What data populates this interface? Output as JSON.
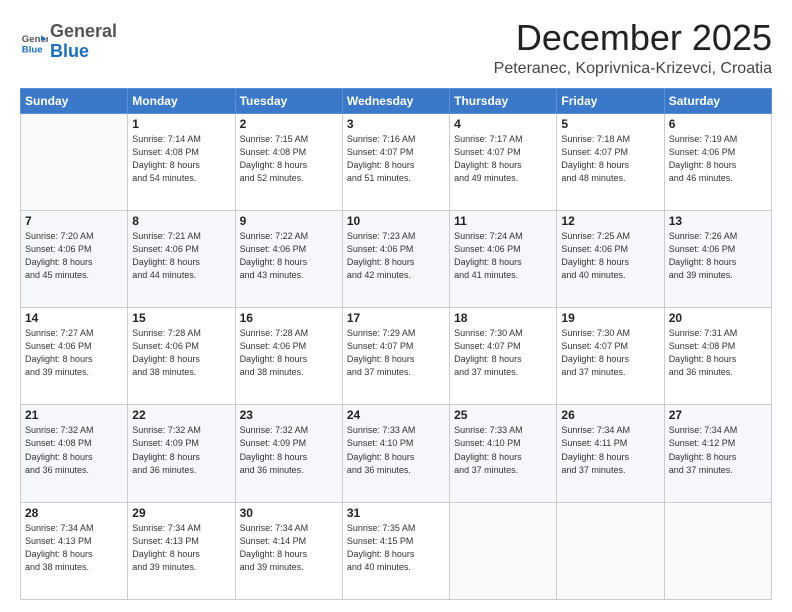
{
  "logo": {
    "general": "General",
    "blue": "Blue"
  },
  "header": {
    "month_year": "December 2025",
    "location": "Peteranec, Koprivnica-Krizevci, Croatia"
  },
  "days_of_week": [
    "Sunday",
    "Monday",
    "Tuesday",
    "Wednesday",
    "Thursday",
    "Friday",
    "Saturday"
  ],
  "weeks": [
    [
      {
        "day": "",
        "info": ""
      },
      {
        "day": "1",
        "info": "Sunrise: 7:14 AM\nSunset: 4:08 PM\nDaylight: 8 hours\nand 54 minutes."
      },
      {
        "day": "2",
        "info": "Sunrise: 7:15 AM\nSunset: 4:08 PM\nDaylight: 8 hours\nand 52 minutes."
      },
      {
        "day": "3",
        "info": "Sunrise: 7:16 AM\nSunset: 4:07 PM\nDaylight: 8 hours\nand 51 minutes."
      },
      {
        "day": "4",
        "info": "Sunrise: 7:17 AM\nSunset: 4:07 PM\nDaylight: 8 hours\nand 49 minutes."
      },
      {
        "day": "5",
        "info": "Sunrise: 7:18 AM\nSunset: 4:07 PM\nDaylight: 8 hours\nand 48 minutes."
      },
      {
        "day": "6",
        "info": "Sunrise: 7:19 AM\nSunset: 4:06 PM\nDaylight: 8 hours\nand 46 minutes."
      }
    ],
    [
      {
        "day": "7",
        "info": "Sunrise: 7:20 AM\nSunset: 4:06 PM\nDaylight: 8 hours\nand 45 minutes."
      },
      {
        "day": "8",
        "info": "Sunrise: 7:21 AM\nSunset: 4:06 PM\nDaylight: 8 hours\nand 44 minutes."
      },
      {
        "day": "9",
        "info": "Sunrise: 7:22 AM\nSunset: 4:06 PM\nDaylight: 8 hours\nand 43 minutes."
      },
      {
        "day": "10",
        "info": "Sunrise: 7:23 AM\nSunset: 4:06 PM\nDaylight: 8 hours\nand 42 minutes."
      },
      {
        "day": "11",
        "info": "Sunrise: 7:24 AM\nSunset: 4:06 PM\nDaylight: 8 hours\nand 41 minutes."
      },
      {
        "day": "12",
        "info": "Sunrise: 7:25 AM\nSunset: 4:06 PM\nDaylight: 8 hours\nand 40 minutes."
      },
      {
        "day": "13",
        "info": "Sunrise: 7:26 AM\nSunset: 4:06 PM\nDaylight: 8 hours\nand 39 minutes."
      }
    ],
    [
      {
        "day": "14",
        "info": "Sunrise: 7:27 AM\nSunset: 4:06 PM\nDaylight: 8 hours\nand 39 minutes."
      },
      {
        "day": "15",
        "info": "Sunrise: 7:28 AM\nSunset: 4:06 PM\nDaylight: 8 hours\nand 38 minutes."
      },
      {
        "day": "16",
        "info": "Sunrise: 7:28 AM\nSunset: 4:06 PM\nDaylight: 8 hours\nand 38 minutes."
      },
      {
        "day": "17",
        "info": "Sunrise: 7:29 AM\nSunset: 4:07 PM\nDaylight: 8 hours\nand 37 minutes."
      },
      {
        "day": "18",
        "info": "Sunrise: 7:30 AM\nSunset: 4:07 PM\nDaylight: 8 hours\nand 37 minutes."
      },
      {
        "day": "19",
        "info": "Sunrise: 7:30 AM\nSunset: 4:07 PM\nDaylight: 8 hours\nand 37 minutes."
      },
      {
        "day": "20",
        "info": "Sunrise: 7:31 AM\nSunset: 4:08 PM\nDaylight: 8 hours\nand 36 minutes."
      }
    ],
    [
      {
        "day": "21",
        "info": "Sunrise: 7:32 AM\nSunset: 4:08 PM\nDaylight: 8 hours\nand 36 minutes."
      },
      {
        "day": "22",
        "info": "Sunrise: 7:32 AM\nSunset: 4:09 PM\nDaylight: 8 hours\nand 36 minutes."
      },
      {
        "day": "23",
        "info": "Sunrise: 7:32 AM\nSunset: 4:09 PM\nDaylight: 8 hours\nand 36 minutes."
      },
      {
        "day": "24",
        "info": "Sunrise: 7:33 AM\nSunset: 4:10 PM\nDaylight: 8 hours\nand 36 minutes."
      },
      {
        "day": "25",
        "info": "Sunrise: 7:33 AM\nSunset: 4:10 PM\nDaylight: 8 hours\nand 37 minutes."
      },
      {
        "day": "26",
        "info": "Sunrise: 7:34 AM\nSunset: 4:11 PM\nDaylight: 8 hours\nand 37 minutes."
      },
      {
        "day": "27",
        "info": "Sunrise: 7:34 AM\nSunset: 4:12 PM\nDaylight: 8 hours\nand 37 minutes."
      }
    ],
    [
      {
        "day": "28",
        "info": "Sunrise: 7:34 AM\nSunset: 4:13 PM\nDaylight: 8 hours\nand 38 minutes."
      },
      {
        "day": "29",
        "info": "Sunrise: 7:34 AM\nSunset: 4:13 PM\nDaylight: 8 hours\nand 39 minutes."
      },
      {
        "day": "30",
        "info": "Sunrise: 7:34 AM\nSunset: 4:14 PM\nDaylight: 8 hours\nand 39 minutes."
      },
      {
        "day": "31",
        "info": "Sunrise: 7:35 AM\nSunset: 4:15 PM\nDaylight: 8 hours\nand 40 minutes."
      },
      {
        "day": "",
        "info": ""
      },
      {
        "day": "",
        "info": ""
      },
      {
        "day": "",
        "info": ""
      }
    ]
  ]
}
